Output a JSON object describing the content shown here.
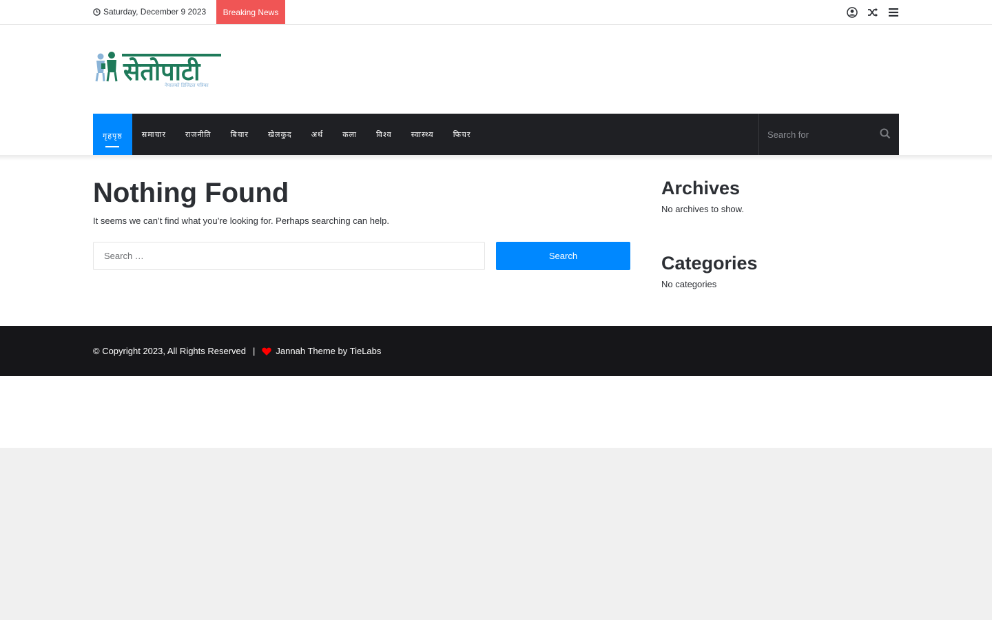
{
  "topbar": {
    "date": "Saturday, December 9 2023",
    "breaking": "Breaking News",
    "icons": [
      "user-login-icon",
      "random-shuffle-icon",
      "menu-icon"
    ]
  },
  "logo": {
    "alt": "सेतोपाटी",
    "wordmark": "सेतोपाटी",
    "tagline": "नेपालको डिजिटल पत्रिका"
  },
  "nav": {
    "items": [
      {
        "label": "गृहपृष्ठ",
        "active": true
      },
      {
        "label": "समाचार",
        "active": false
      },
      {
        "label": "राजनीति",
        "active": false
      },
      {
        "label": "बिचार",
        "active": false
      },
      {
        "label": "खेलकुद",
        "active": false
      },
      {
        "label": "अर्थ",
        "active": false
      },
      {
        "label": "कला",
        "active": false
      },
      {
        "label": "विश्व",
        "active": false
      },
      {
        "label": "स्वास्थ्य",
        "active": false
      },
      {
        "label": "फिचर",
        "active": false
      }
    ],
    "search_placeholder": "Search for"
  },
  "main": {
    "title": "Nothing Found",
    "text": "It seems we can’t find what you’re looking for. Perhaps searching can help.",
    "search_placeholder": "Search …",
    "search_button": "Search"
  },
  "sidebar": {
    "archives_title": "Archives",
    "archives_text": "No archives to show.",
    "categories_title": "Categories",
    "categories_text": "No categories"
  },
  "footer": {
    "copyright": "© Copyright 2023, All Rights Reserved",
    "separator": "|",
    "credit": "Jannah Theme by TieLabs"
  },
  "colors": {
    "accent": "#0088ff",
    "breaking": "#f05555",
    "nav_bg": "#1f2024",
    "footer_bg": "#161619",
    "logo_green": "#1e7a5a",
    "heart": "#ff0000"
  }
}
